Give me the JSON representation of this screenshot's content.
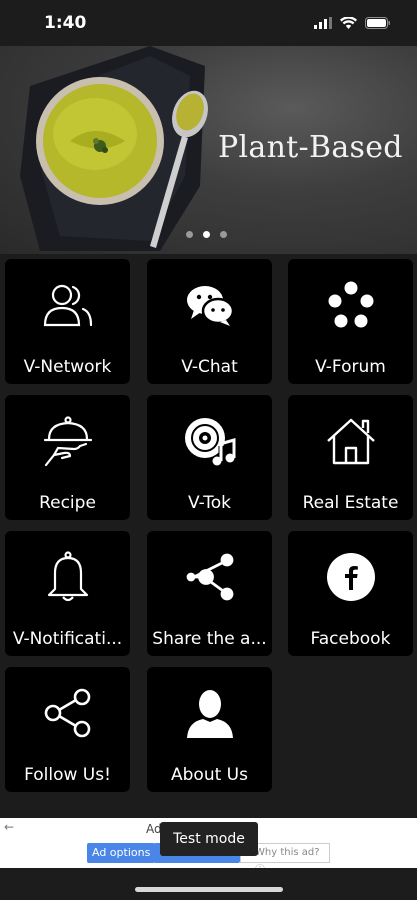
{
  "status": {
    "time": "1:40"
  },
  "banner": {
    "title": "Plant-Based",
    "slide_count": 3,
    "active_slide": 2
  },
  "tiles": [
    {
      "label": "V-Network",
      "icon": "people-icon"
    },
    {
      "label": "V-Chat",
      "icon": "chat-bubbles-icon"
    },
    {
      "label": "V-Forum",
      "icon": "dots-cluster-icon"
    },
    {
      "label": "Recipe",
      "icon": "serving-cloche-icon"
    },
    {
      "label": "V-Tok",
      "icon": "music-disc-icon"
    },
    {
      "label": "Real Estate",
      "icon": "house-icon"
    },
    {
      "label": "V-Notificati...",
      "icon": "bell-icon"
    },
    {
      "label": "Share the a...",
      "icon": "share-icon"
    },
    {
      "label": "Facebook",
      "icon": "facebook-icon"
    },
    {
      "label": "Follow Us!",
      "icon": "share-outline-icon"
    },
    {
      "label": "About Us",
      "icon": "person-icon"
    }
  ],
  "ad": {
    "text": "Ad",
    "options_label": "Ad options",
    "why_label": "Why this ad? ⓘ",
    "test_mode": "Test mode"
  }
}
